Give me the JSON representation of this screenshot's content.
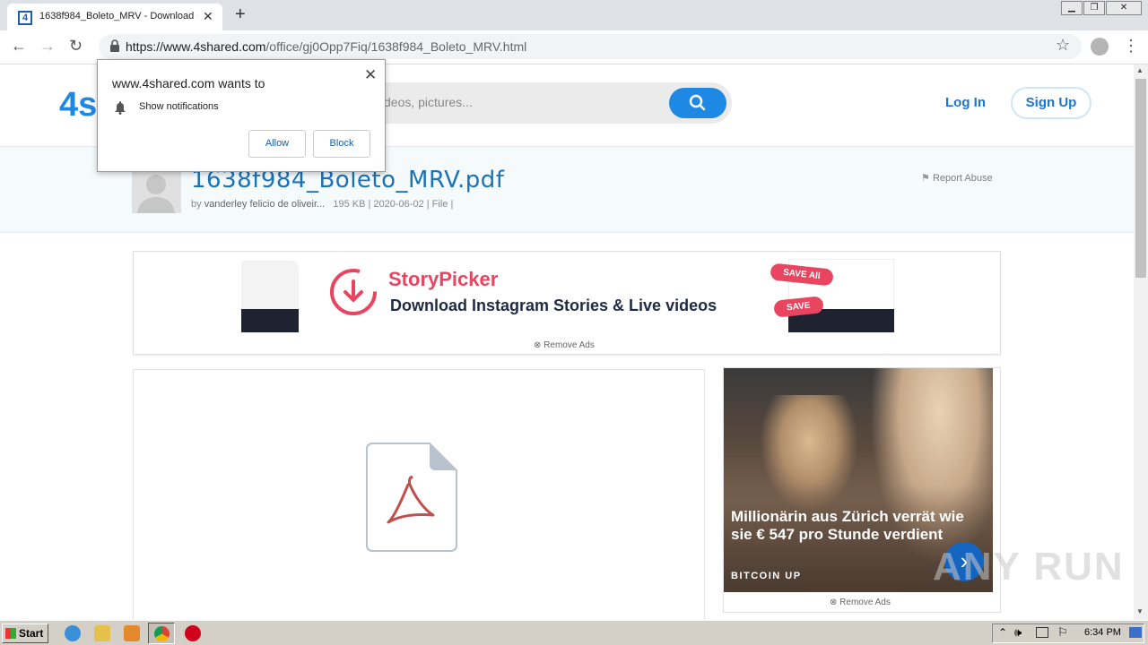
{
  "browser": {
    "tab_title": "1638f984_Boleto_MRV - Download -",
    "url_host": "https://www.4shared.com",
    "url_path": "/office/gj0Opp7Fiq/1638f984_Boleto_MRV.html",
    "favicon_text": "4"
  },
  "site": {
    "logo_text": "4s",
    "search_placeholder": "deos, pictures...",
    "login_label": "Log In",
    "signup_label": "Sign Up"
  },
  "file": {
    "title": "1638f984_Boleto_MRV.pdf",
    "meta_by": "by",
    "meta_author": "vanderley felicio de oliveir...",
    "meta_details": "195 KB | 2020-06-02 | File |",
    "report_label": "Report Abuse"
  },
  "ads": {
    "top_brand": "StoryPicker",
    "top_tagline": "Download Instagram Stories & Live videos",
    "save_all_label": "SAVE All",
    "save_label": "SAVE",
    "remove_ads_label": "Remove Ads",
    "side_headline": "Millionärin aus Zürich verrät wie sie € 547 pro Stunde verdient",
    "side_source": "BITCOIN UP"
  },
  "notification": {
    "title": "www.4shared.com wants to",
    "message": "Show notifications",
    "allow_label": "Allow",
    "block_label": "Block"
  },
  "taskbar": {
    "start_label": "Start",
    "clock": "6:34 PM"
  },
  "watermark": "ANY RUN",
  "colors": {
    "accent": "#1e88e5",
    "ad_brand": "#e94560"
  }
}
